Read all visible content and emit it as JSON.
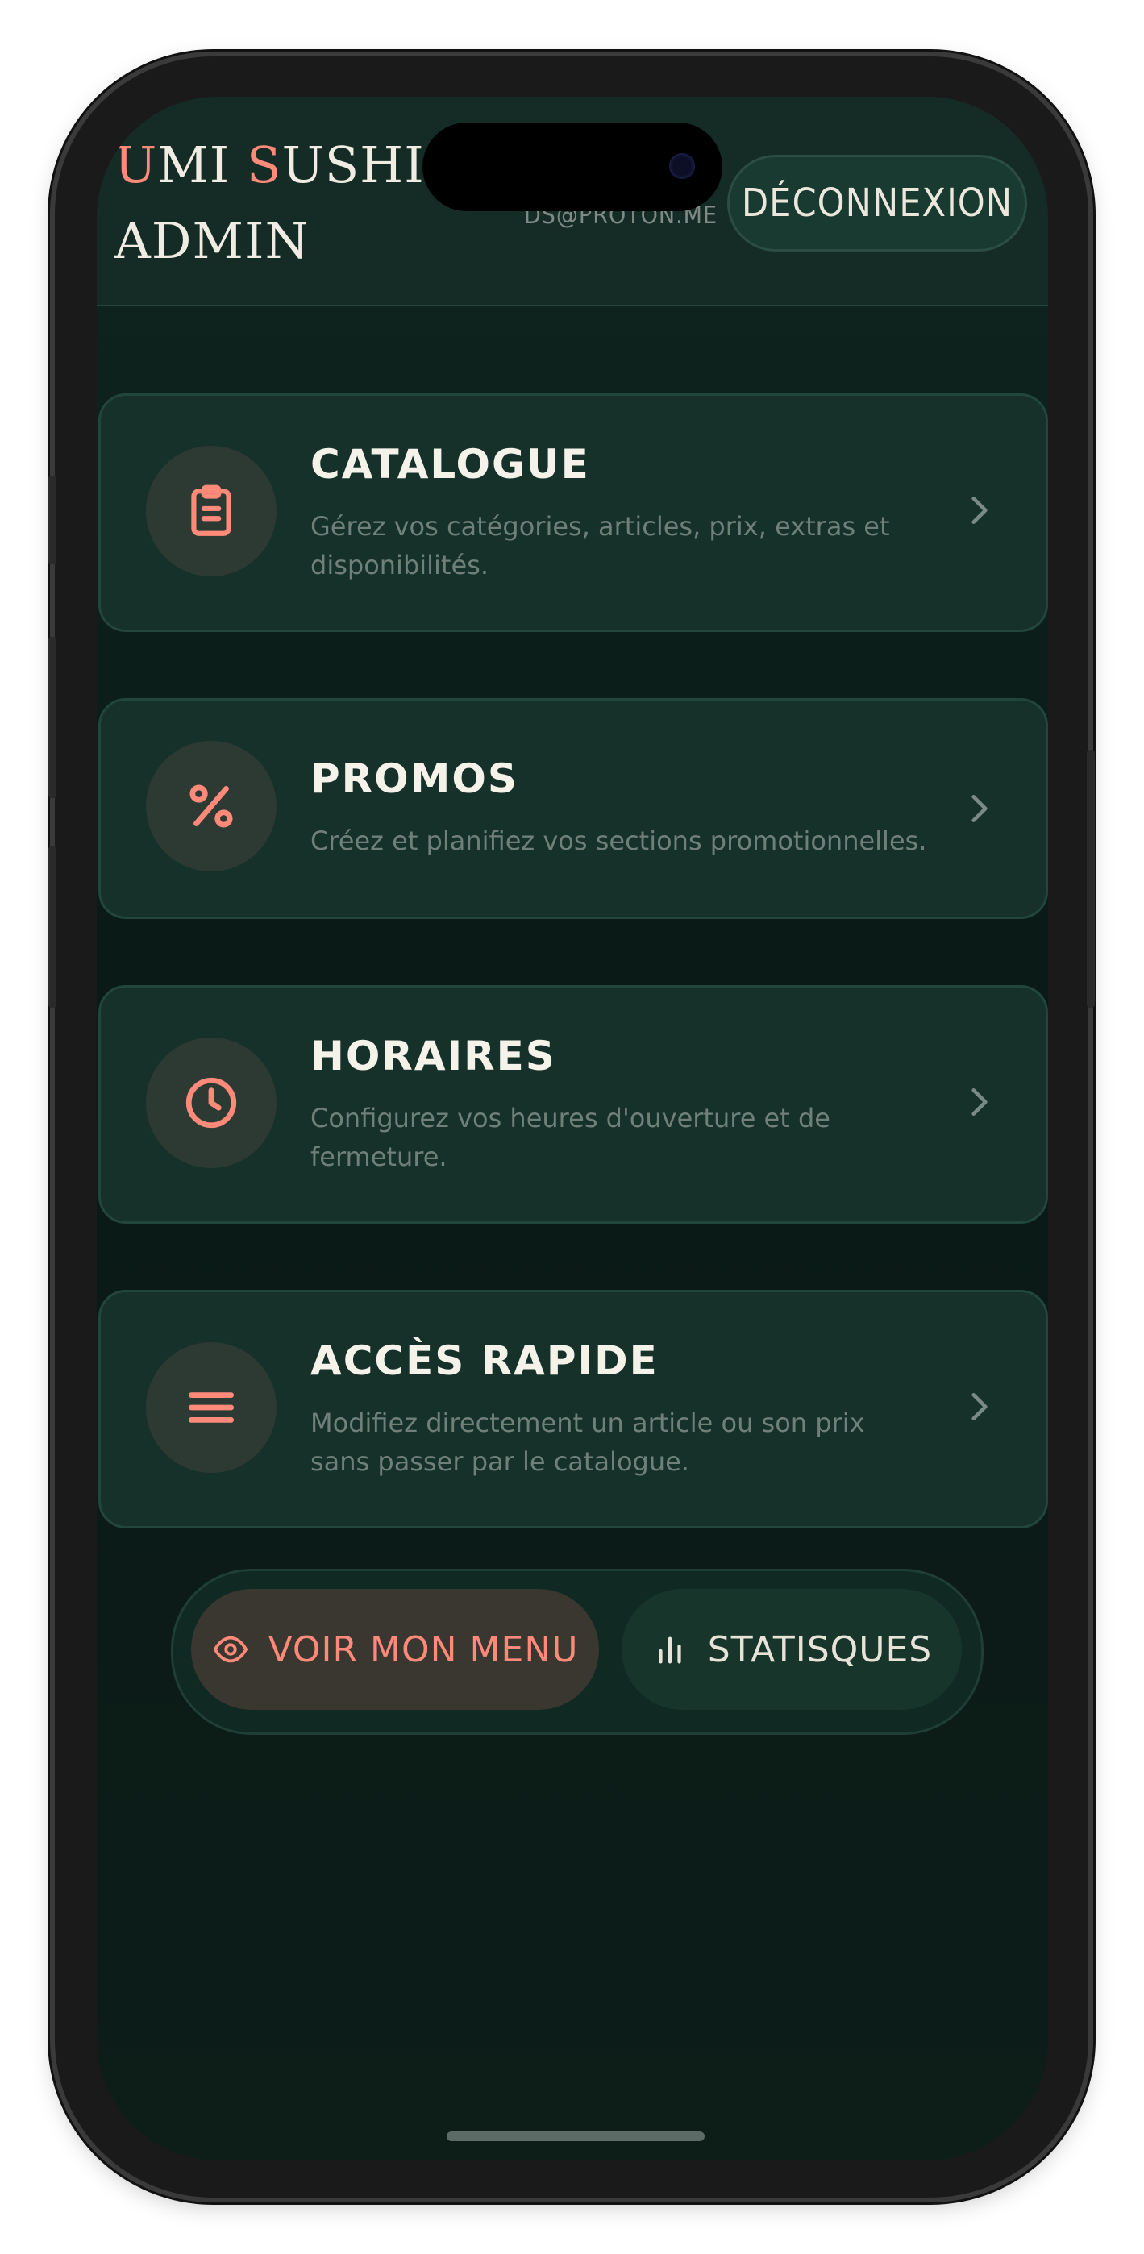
{
  "header": {
    "brand": {
      "accent1": "U",
      "part1": "MI ",
      "accent2": "S",
      "part2": "USHI",
      "line2": "ADMIN"
    },
    "email": "DS@PROTON.ME",
    "logout_label": "DÉCONNEXION"
  },
  "cards": [
    {
      "title": "CATALOGUE",
      "desc": "Gérez vos catégories, articles, prix, extras et disponibilités.",
      "icon": "clipboard-icon"
    },
    {
      "title": "PROMOS",
      "desc": "Créez et planifiez vos sections promotionnelles.",
      "icon": "percent-icon"
    },
    {
      "title": "HORAIRES",
      "desc": "Configurez vos heures d'ouverture et de fermeture.",
      "icon": "clock-icon"
    },
    {
      "title": "ACCÈS RAPIDE",
      "desc": "Modifiez directement un article ou son prix sans passer par le catalogue.",
      "icon": "menu-lines-icon"
    }
  ],
  "actions": {
    "view_menu_label": "VOIR MON MENU",
    "stats_label": "STATISQUES"
  },
  "colors": {
    "accent": "#ff8a7a",
    "background": "#0d1d18",
    "card": "#16302a"
  }
}
